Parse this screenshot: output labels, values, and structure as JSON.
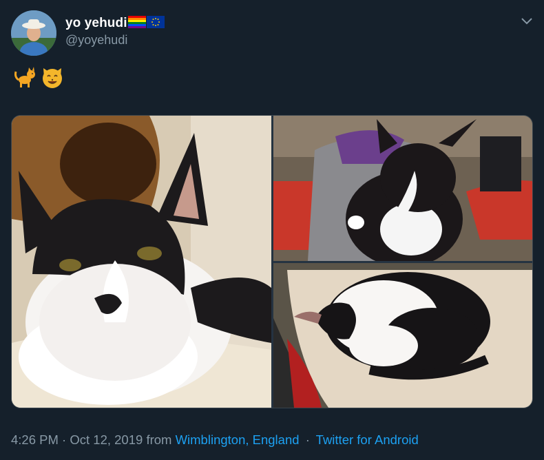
{
  "author": {
    "display_name": "yo yehudi",
    "handle": "@yoyehudi",
    "flags": [
      "rainbow-flag-icon",
      "eu-flag-icon"
    ]
  },
  "tweet": {
    "emojis": [
      "cat-emoji",
      "cat-face-emoji"
    ]
  },
  "media": {
    "photos": [
      "photo-cat-closeup",
      "photo-cat-on-lap",
      "photo-cat-curled-up"
    ]
  },
  "footer": {
    "time": "4:26 PM",
    "separator": "·",
    "date": "Oct 12, 2019",
    "from_label": "from",
    "location": "Wimblington, England",
    "client": "Twitter for Android"
  },
  "colors": {
    "background": "#15202b",
    "secondary_text": "#8899a6",
    "link": "#1da1f2"
  }
}
